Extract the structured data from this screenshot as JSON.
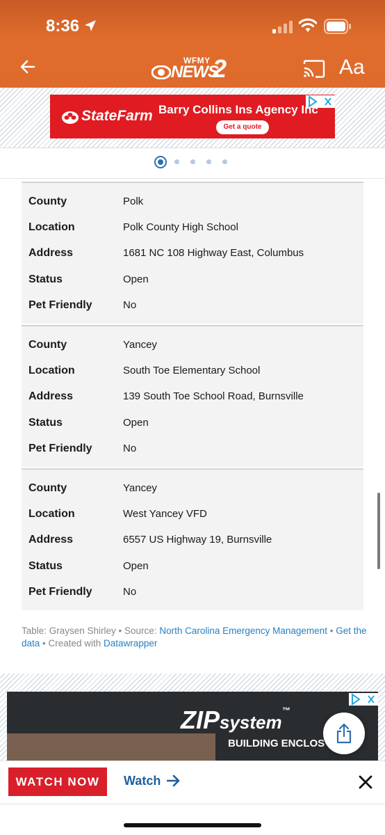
{
  "status_bar": {
    "time": "8:36"
  },
  "header": {
    "logo_small": "WFMY",
    "logo_main": "NEWS",
    "logo_num": "2",
    "text_size_label": "Aa"
  },
  "top_ad": {
    "brand": "StateFarm",
    "headline": "Barry Collins Ins Agency Inc",
    "cta": "Get a quote"
  },
  "carousel": {
    "count": 5,
    "active_index": 0
  },
  "table": {
    "records": [
      {
        "county_label": "County",
        "county": "Polk",
        "location_label": "Location",
        "location": "Polk County High School",
        "address_label": "Address",
        "address": "1681 NC 108 Highway East, Columbus",
        "status_label": "Status",
        "status": "Open",
        "pet_label": "Pet Friendly",
        "pet": "No"
      },
      {
        "county_label": "County",
        "county": "Yancey",
        "location_label": "Location",
        "location": "South Toe Elementary School",
        "address_label": "Address",
        "address": "139 South Toe School Road, Burnsville",
        "status_label": "Status",
        "status": "Open",
        "pet_label": "Pet Friendly",
        "pet": "No"
      },
      {
        "county_label": "County",
        "county": "Yancey",
        "location_label": "Location",
        "location": "West Yancey VFD",
        "address_label": "Address",
        "address": "6557 US Highway 19, Burnsville",
        "status_label": "Status",
        "status": "Open",
        "pet_label": "Pet Friendly",
        "pet": "No"
      }
    ]
  },
  "credits": {
    "prefix": "Table: Graysen Shirley • Source: ",
    "source_link": "North Carolina Emergency Management",
    "sep1": " • ",
    "get_data_link": "Get the data",
    "sep2": " • Created with ",
    "tool_link": "Datawrapper"
  },
  "bottom_ad": {
    "brand": "ZIP",
    "brand_suffix": "system",
    "tm": "™",
    "tagline": "BUILDING ENCLOS"
  },
  "watch_bar": {
    "watch_now": "WATCH NOW",
    "watch_link": "Watch"
  },
  "colors": {
    "header_orange": "#de6a2b",
    "statefarm_red": "#e01b22",
    "watch_red": "#d81f2a",
    "link_blue": "#2680c2"
  },
  "icons": [
    "location-arrow-icon",
    "signal-icon",
    "wifi-icon",
    "battery-icon",
    "back-arrow-icon",
    "cast-icon",
    "adchoices-icon",
    "close-icon",
    "share-icon",
    "arrow-right-icon"
  ]
}
